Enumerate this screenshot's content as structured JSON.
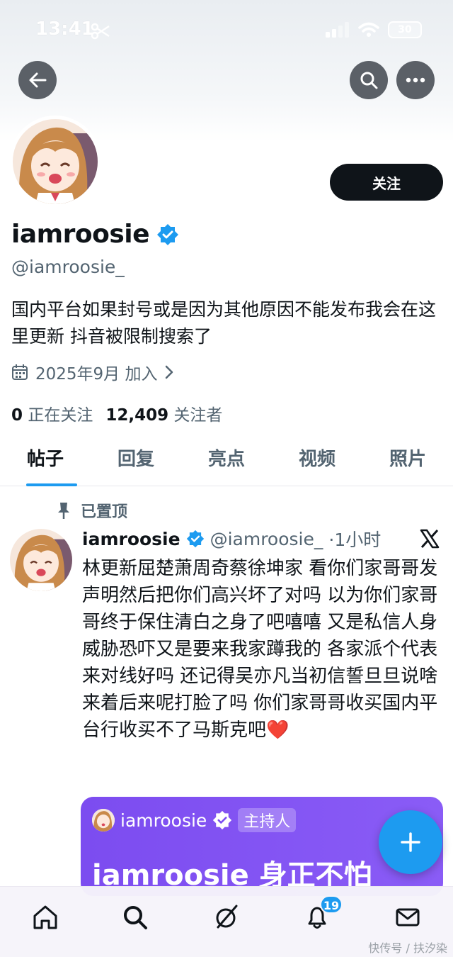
{
  "status_bar": {
    "time": "13:41",
    "battery": "30"
  },
  "profile": {
    "follow_label": "关注",
    "display_name": "iamroosie",
    "handle": "@iamroosie_",
    "bio": "国内平台如果封号或是因为其他原因不能发布我会在这里更新 抖音被限制搜索了",
    "joined": "2025年9月 加入",
    "following_count": "0",
    "following_label": "正在关注",
    "followers_count": "12,409",
    "followers_label": "关注者"
  },
  "tabs": [
    {
      "label": "帖子",
      "active": true
    },
    {
      "label": "回复",
      "active": false
    },
    {
      "label": "亮点",
      "active": false
    },
    {
      "label": "视频",
      "active": false
    },
    {
      "label": "照片",
      "active": false
    }
  ],
  "post": {
    "pinned_label": "已置顶",
    "author_name": "iamroosie",
    "author_handle": "@iamroosie_",
    "time": "·1小时",
    "text": "林更新屈楚萧周奇蔡徐坤家 看你们家哥哥发声明然后把你们高兴坏了对吗 以为你们家哥哥终于保住清白之身了吧嘻嘻 又是私信人身威胁恐吓又是要来我家蹲我的 各家派个代表来对线好吗 还记得吴亦凡当初信誓旦旦说啥来着后来呢打脸了吗 你们家哥哥收买国内平台行收买不了马斯克吧❤️",
    "quote": {
      "name": "iamroosie",
      "badge": "主持人",
      "title": "iamroosie 身正不怕"
    }
  },
  "bottom_nav": {
    "items": [
      "home-icon",
      "search-icon",
      "grok-icon",
      "notifications-icon",
      "messages-icon"
    ],
    "notification_count": "19"
  },
  "watermark": "快传号 / 扶汐染",
  "colors": {
    "accent": "#1d9bf0",
    "text": "#0f1419",
    "secondary": "#536471",
    "quote_bg": "#7c4cf0"
  }
}
